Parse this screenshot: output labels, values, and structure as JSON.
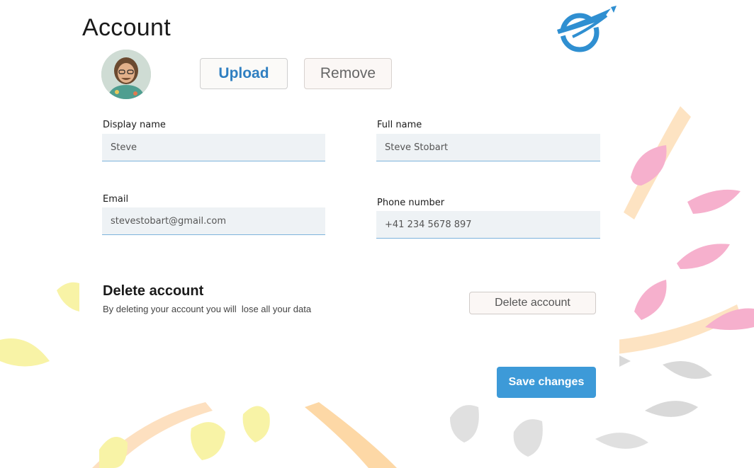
{
  "page": {
    "title": "Account"
  },
  "logo": {
    "icon": "plane-globe-logo-icon"
  },
  "avatar": {
    "icon": "user-avatar-photo"
  },
  "photo_actions": {
    "upload_label": "Upload",
    "remove_label": "Remove"
  },
  "form": {
    "display_name": {
      "label": "Display name",
      "value": "Steve"
    },
    "full_name": {
      "label": "Full name",
      "value": "Steve Stobart"
    },
    "email": {
      "label": "Email",
      "value": "stevestobart@gmail.com"
    },
    "phone": {
      "label": "Phone number",
      "value": "+41 234 5678 897"
    }
  },
  "delete_section": {
    "title": "Delete account",
    "description": "By deleting your account you will  lose all your data",
    "button_label": "Delete account"
  },
  "footer": {
    "save_label": "Save changes"
  },
  "colors": {
    "accent": "#3d9ad8",
    "upload_text": "#2f7fc1",
    "input_bg": "#eef2f5",
    "input_underline": "#7db3dc",
    "leaf_pink": "#f4a7c8",
    "leaf_yellow": "#f8f3a6",
    "leaf_orange": "#fcd9a8",
    "leaf_gray": "#d3d3d3"
  }
}
